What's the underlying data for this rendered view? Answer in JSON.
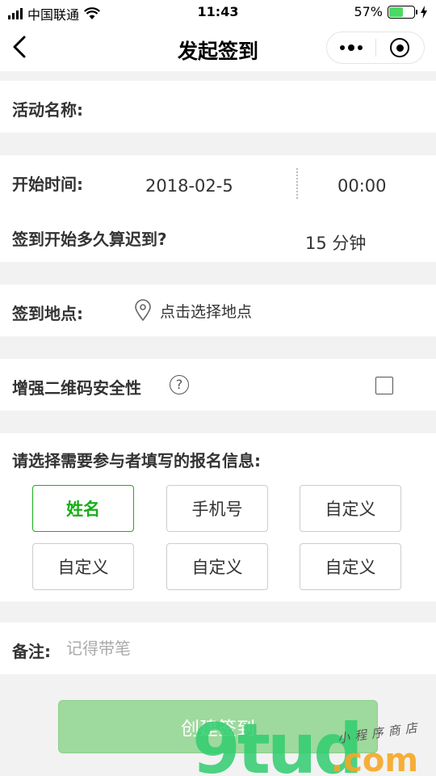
{
  "status_bar": {
    "carrier": "中国联通",
    "time": "11:43",
    "battery": "57%",
    "battery_level": 0.57
  },
  "nav": {
    "title": "发起签到"
  },
  "activity": {
    "label": "活动名称:",
    "value": ""
  },
  "schedule": {
    "start_label": "开始时间:",
    "date": "2018-02-5",
    "time": "00:00",
    "late_label": "签到开始多久算迟到?",
    "late_value": "15 分钟"
  },
  "location": {
    "label": "签到地点:",
    "placeholder": "点击选择地点"
  },
  "security": {
    "label": "增强二维码安全性",
    "help": "?",
    "checked": false
  },
  "registration": {
    "label": "请选择需要参与者填写的报名信息:",
    "fields": [
      {
        "label": "姓名",
        "selected": true
      },
      {
        "label": "手机号",
        "selected": false
      },
      {
        "label": "自定义",
        "selected": false
      },
      {
        "label": "自定义",
        "selected": false
      },
      {
        "label": "自定义",
        "selected": false
      },
      {
        "label": "自定义",
        "selected": false
      }
    ]
  },
  "remark": {
    "label": "备注:",
    "placeholder": "记得带笔"
  },
  "submit": {
    "label": "创建签到"
  },
  "watermark": {
    "logo": "9tud",
    "domain": ".com",
    "tagline": "小程序商店"
  },
  "colors": {
    "accent": "#1aad19",
    "button_disabled": "#9ed99d",
    "background": "#f2f2f2"
  }
}
